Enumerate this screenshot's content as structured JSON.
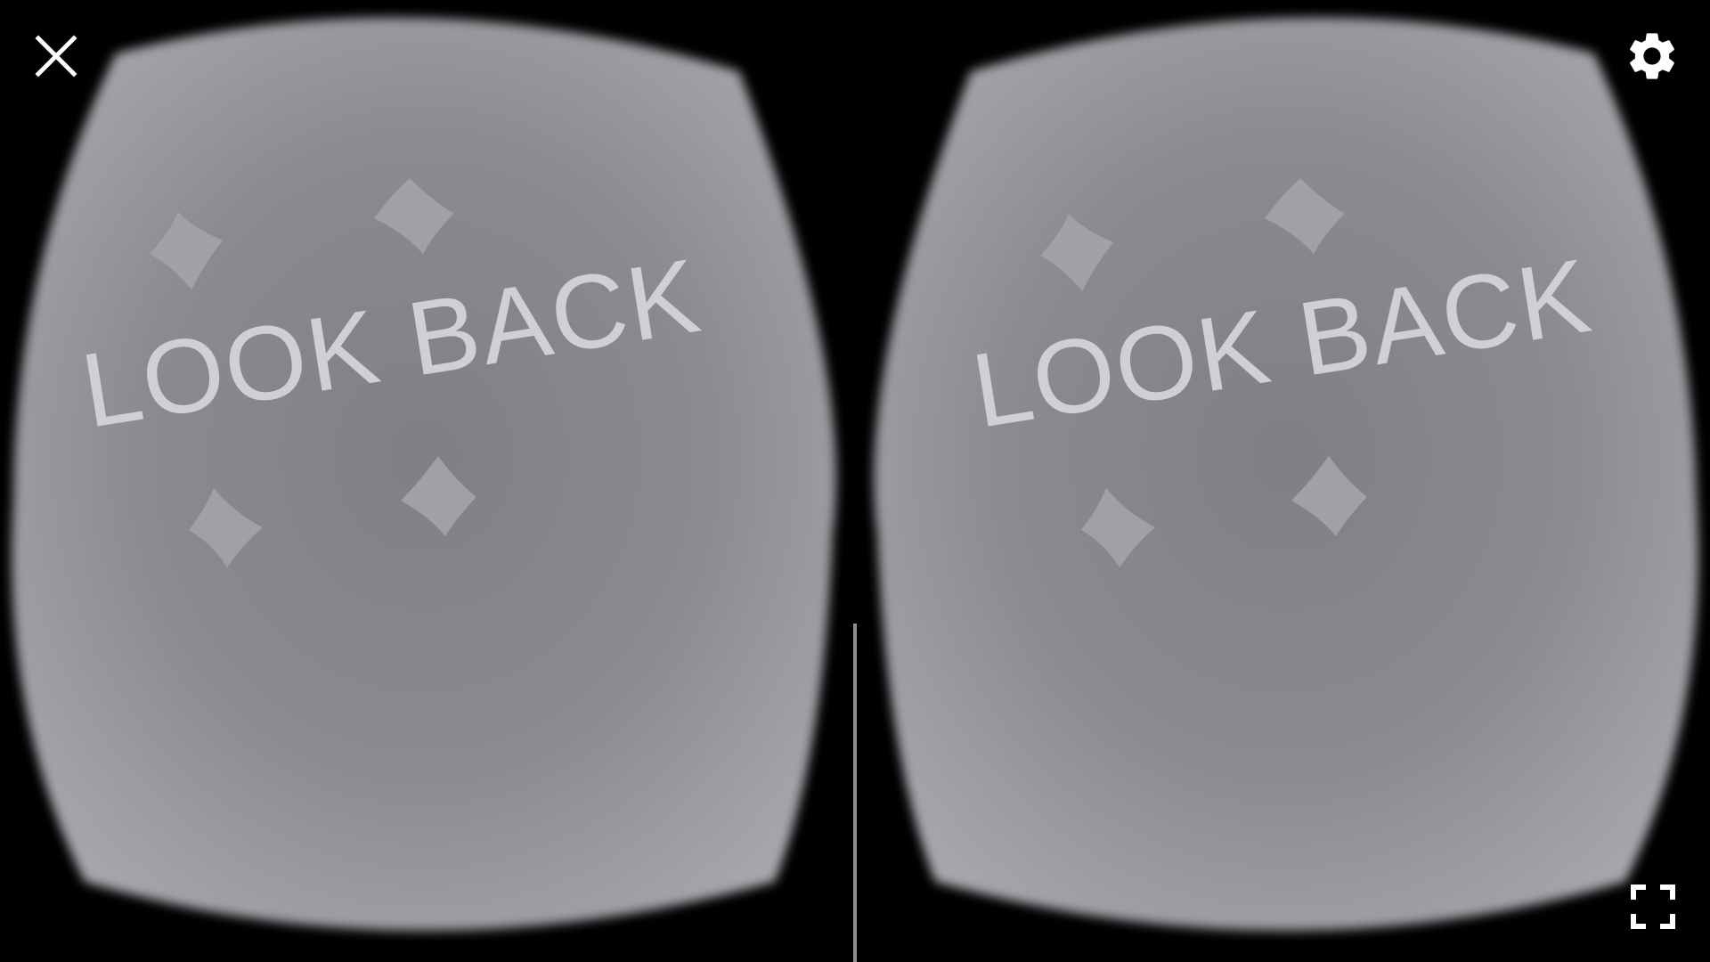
{
  "scene": {
    "message": "LOOK BACK",
    "background_color": "#000000",
    "lens_color": "#8c8d92",
    "text_color": "#cfd0d4",
    "marker_color": "#a3a4a8"
  },
  "controls": {
    "close_icon": "close-icon",
    "settings_icon": "gear-icon",
    "fullscreen_icon": "fullscreen-icon"
  }
}
